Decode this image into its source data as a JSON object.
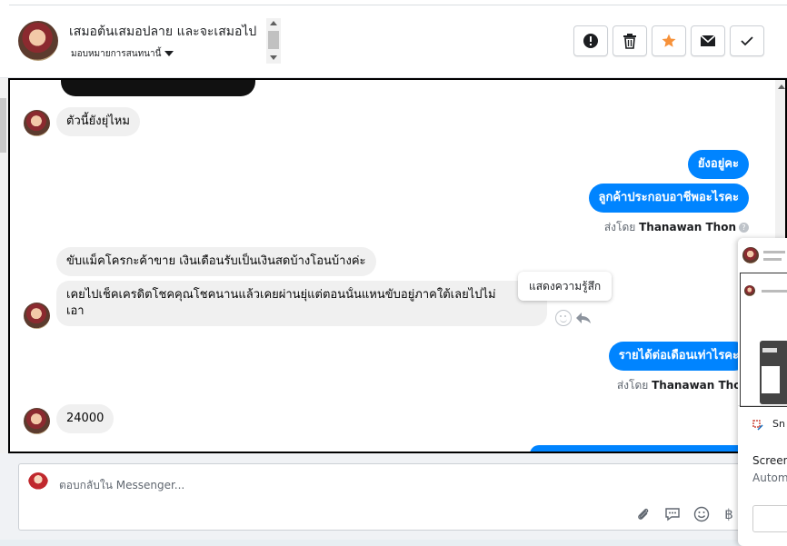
{
  "header": {
    "title": "เสมอต้นเสมอปลาย และจะเสมอไป",
    "assign_label": "มอบหมายการสนทนานี้"
  },
  "actions": [
    {
      "name": "spam-button",
      "icon": "exclamation-icon"
    },
    {
      "name": "delete-button",
      "icon": "trash-icon"
    },
    {
      "name": "star-button",
      "icon": "star-icon"
    },
    {
      "name": "mark-unread-button",
      "icon": "envelope-icon"
    },
    {
      "name": "done-button",
      "icon": "check-icon"
    }
  ],
  "colors": {
    "outgoing": "#0084ff",
    "incoming": "#f0f0f0",
    "star": "#f7923a"
  },
  "messages": {
    "m1": "ตัวนี้ยังยุ่ไหม",
    "m2": "ยังอยู่คะ",
    "m3": "ลูกค้าประกอบอาชีพอะไรคะ",
    "sent_by_prefix": "ส่งโดย",
    "sent_by_name": "Thanawan Thon",
    "m4": "ขับแม็คโครกะค้าขาย เงินเดือนรับเป็นเงินสดบ้างโอนบ้างค่ะ",
    "m5_line1": "เคยไปเช็คเครดิตโชคคุณโชคนานแล้วเคยผ่านยุ่แต่ตอนนั้นแหนขับอยู่ภาคใต้เลยไปไม่",
    "m5_line2": "เอา",
    "m6": "รายได้ต่อเดือนเท่าไรคะ",
    "m7": "24000"
  },
  "tooltip": "แสดงความรู้สึก",
  "composer": {
    "placeholder": "ตอบกลับใน Messenger..."
  },
  "snip": {
    "app": "Sn",
    "line1": "Screen",
    "line2": "Autom"
  }
}
